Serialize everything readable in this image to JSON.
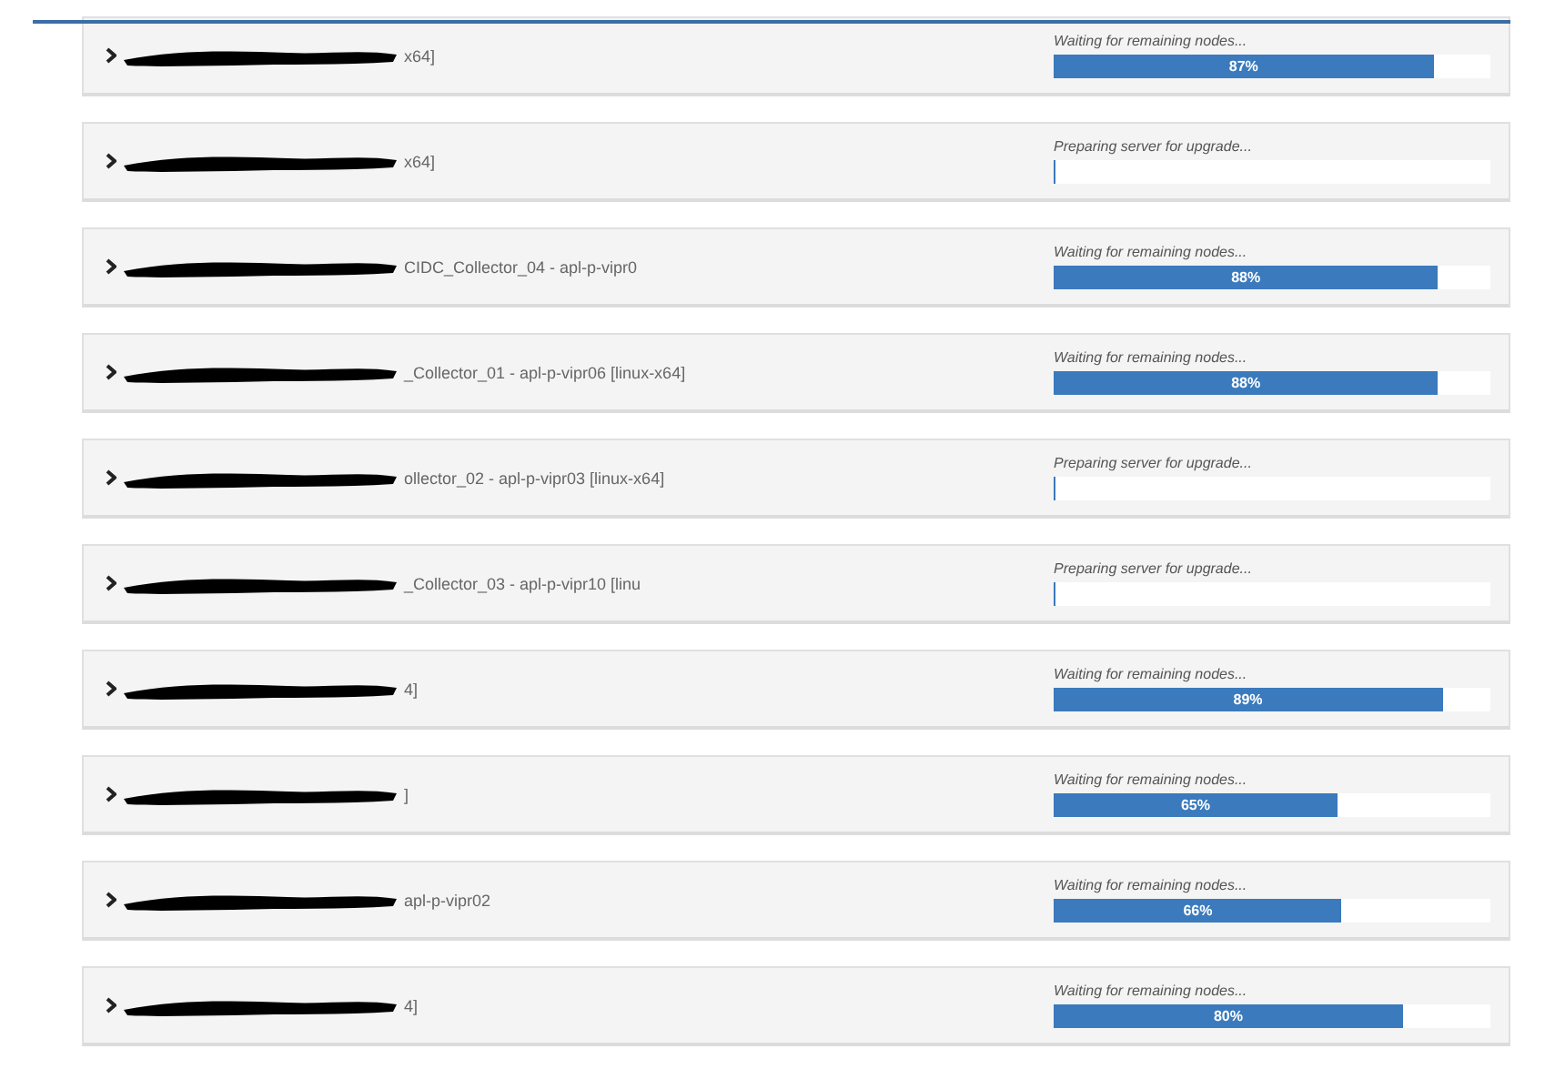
{
  "servers": [
    {
      "name": "x64]",
      "status": "Waiting for remaining nodes...",
      "level": 0.87,
      "percent": "87%"
    },
    {
      "name": "x64]",
      "status": "Preparing server for upgrade...",
      "level": 0
    },
    {
      "name": "CIDC_Collector_04 - apl-p-vipr0",
      "status": "Waiting for remaining nodes...",
      "level": 0.88,
      "percent": "88%"
    },
    {
      "name": "_Collector_01 - apl-p-vipr06 [linux-x64]",
      "status": "Waiting for remaining nodes...",
      "level": 0.88,
      "percent": "88%"
    },
    {
      "name": "ollector_02 - apl-p-vipr03 [linux-x64]",
      "status": "Preparing server for upgrade...",
      "level": 0
    },
    {
      "name": "_Collector_03 - apl-p-vipr10 [linu",
      "status": "Preparing server for upgrade...",
      "level": 0
    },
    {
      "name": "4]",
      "status": "Waiting for remaining nodes...",
      "level": 0.89,
      "percent": "89%"
    },
    {
      "name": "]",
      "status": "Waiting for remaining nodes...",
      "level": 0.65,
      "percent": "65%"
    },
    {
      "name": "apl-p-vipr02",
      "status": "Waiting for remaining nodes...",
      "level": 0.66,
      "percent": "66%"
    },
    {
      "name": "4]",
      "status": "Waiting for remaining nodes...",
      "level": 0.8,
      "percent": "80%"
    }
  ]
}
